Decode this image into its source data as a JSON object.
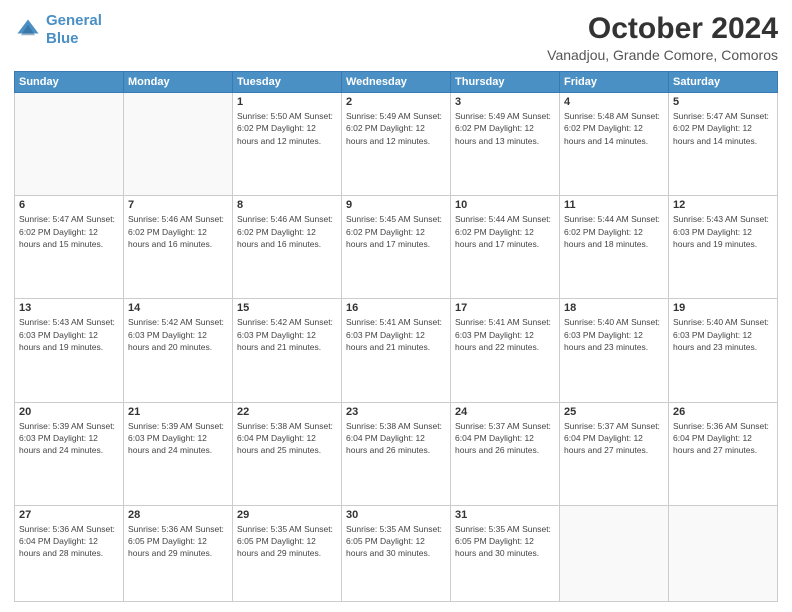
{
  "logo": {
    "line1": "General",
    "line2": "Blue"
  },
  "title": "October 2024",
  "subtitle": "Vanadjou, Grande Comore, Comoros",
  "days_of_week": [
    "Sunday",
    "Monday",
    "Tuesday",
    "Wednesday",
    "Thursday",
    "Friday",
    "Saturday"
  ],
  "weeks": [
    [
      {
        "num": "",
        "detail": ""
      },
      {
        "num": "",
        "detail": ""
      },
      {
        "num": "1",
        "detail": "Sunrise: 5:50 AM\nSunset: 6:02 PM\nDaylight: 12 hours\nand 12 minutes."
      },
      {
        "num": "2",
        "detail": "Sunrise: 5:49 AM\nSunset: 6:02 PM\nDaylight: 12 hours\nand 12 minutes."
      },
      {
        "num": "3",
        "detail": "Sunrise: 5:49 AM\nSunset: 6:02 PM\nDaylight: 12 hours\nand 13 minutes."
      },
      {
        "num": "4",
        "detail": "Sunrise: 5:48 AM\nSunset: 6:02 PM\nDaylight: 12 hours\nand 14 minutes."
      },
      {
        "num": "5",
        "detail": "Sunrise: 5:47 AM\nSunset: 6:02 PM\nDaylight: 12 hours\nand 14 minutes."
      }
    ],
    [
      {
        "num": "6",
        "detail": "Sunrise: 5:47 AM\nSunset: 6:02 PM\nDaylight: 12 hours\nand 15 minutes."
      },
      {
        "num": "7",
        "detail": "Sunrise: 5:46 AM\nSunset: 6:02 PM\nDaylight: 12 hours\nand 16 minutes."
      },
      {
        "num": "8",
        "detail": "Sunrise: 5:46 AM\nSunset: 6:02 PM\nDaylight: 12 hours\nand 16 minutes."
      },
      {
        "num": "9",
        "detail": "Sunrise: 5:45 AM\nSunset: 6:02 PM\nDaylight: 12 hours\nand 17 minutes."
      },
      {
        "num": "10",
        "detail": "Sunrise: 5:44 AM\nSunset: 6:02 PM\nDaylight: 12 hours\nand 17 minutes."
      },
      {
        "num": "11",
        "detail": "Sunrise: 5:44 AM\nSunset: 6:02 PM\nDaylight: 12 hours\nand 18 minutes."
      },
      {
        "num": "12",
        "detail": "Sunrise: 5:43 AM\nSunset: 6:03 PM\nDaylight: 12 hours\nand 19 minutes."
      }
    ],
    [
      {
        "num": "13",
        "detail": "Sunrise: 5:43 AM\nSunset: 6:03 PM\nDaylight: 12 hours\nand 19 minutes."
      },
      {
        "num": "14",
        "detail": "Sunrise: 5:42 AM\nSunset: 6:03 PM\nDaylight: 12 hours\nand 20 minutes."
      },
      {
        "num": "15",
        "detail": "Sunrise: 5:42 AM\nSunset: 6:03 PM\nDaylight: 12 hours\nand 21 minutes."
      },
      {
        "num": "16",
        "detail": "Sunrise: 5:41 AM\nSunset: 6:03 PM\nDaylight: 12 hours\nand 21 minutes."
      },
      {
        "num": "17",
        "detail": "Sunrise: 5:41 AM\nSunset: 6:03 PM\nDaylight: 12 hours\nand 22 minutes."
      },
      {
        "num": "18",
        "detail": "Sunrise: 5:40 AM\nSunset: 6:03 PM\nDaylight: 12 hours\nand 23 minutes."
      },
      {
        "num": "19",
        "detail": "Sunrise: 5:40 AM\nSunset: 6:03 PM\nDaylight: 12 hours\nand 23 minutes."
      }
    ],
    [
      {
        "num": "20",
        "detail": "Sunrise: 5:39 AM\nSunset: 6:03 PM\nDaylight: 12 hours\nand 24 minutes."
      },
      {
        "num": "21",
        "detail": "Sunrise: 5:39 AM\nSunset: 6:03 PM\nDaylight: 12 hours\nand 24 minutes."
      },
      {
        "num": "22",
        "detail": "Sunrise: 5:38 AM\nSunset: 6:04 PM\nDaylight: 12 hours\nand 25 minutes."
      },
      {
        "num": "23",
        "detail": "Sunrise: 5:38 AM\nSunset: 6:04 PM\nDaylight: 12 hours\nand 26 minutes."
      },
      {
        "num": "24",
        "detail": "Sunrise: 5:37 AM\nSunset: 6:04 PM\nDaylight: 12 hours\nand 26 minutes."
      },
      {
        "num": "25",
        "detail": "Sunrise: 5:37 AM\nSunset: 6:04 PM\nDaylight: 12 hours\nand 27 minutes."
      },
      {
        "num": "26",
        "detail": "Sunrise: 5:36 AM\nSunset: 6:04 PM\nDaylight: 12 hours\nand 27 minutes."
      }
    ],
    [
      {
        "num": "27",
        "detail": "Sunrise: 5:36 AM\nSunset: 6:04 PM\nDaylight: 12 hours\nand 28 minutes."
      },
      {
        "num": "28",
        "detail": "Sunrise: 5:36 AM\nSunset: 6:05 PM\nDaylight: 12 hours\nand 29 minutes."
      },
      {
        "num": "29",
        "detail": "Sunrise: 5:35 AM\nSunset: 6:05 PM\nDaylight: 12 hours\nand 29 minutes."
      },
      {
        "num": "30",
        "detail": "Sunrise: 5:35 AM\nSunset: 6:05 PM\nDaylight: 12 hours\nand 30 minutes."
      },
      {
        "num": "31",
        "detail": "Sunrise: 5:35 AM\nSunset: 6:05 PM\nDaylight: 12 hours\nand 30 minutes."
      },
      {
        "num": "",
        "detail": ""
      },
      {
        "num": "",
        "detail": ""
      }
    ]
  ]
}
